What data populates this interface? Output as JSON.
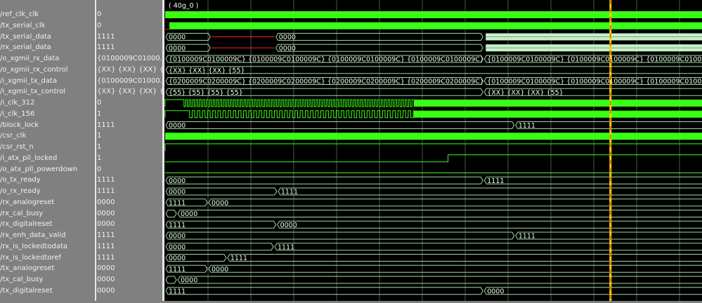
{
  "cursor_label": "( 40g_0 )",
  "cursor_time": 10.39,
  "grid_units": 13,
  "colors": {
    "wave": "#39ff14",
    "bus": "#9fd89f",
    "cursor": "#ffd200",
    "x_state": "#ff2020",
    "grid": "#4a4a4a"
  },
  "signals": [
    {
      "name": "/ref_clk_clk",
      "value": "0",
      "type": "solid",
      "start": 0
    },
    {
      "name": "/tx_serial_clk",
      "value": "0",
      "type": "solid",
      "start": 0.1,
      "red_start": true
    },
    {
      "name": "/tx_serial_data",
      "value": "1111",
      "type": "bus",
      "segs": [
        {
          "t": 0,
          "v": "0000"
        },
        {
          "t": 1.07,
          "v": "",
          "x": true
        },
        {
          "t": 2.57,
          "v": "0000"
        },
        {
          "t": 7.43,
          "v": "",
          "dense": true
        }
      ]
    },
    {
      "name": "/rx_serial_data",
      "value": "1111",
      "type": "bus",
      "segs": [
        {
          "t": 0,
          "v": "0000"
        },
        {
          "t": 1.07,
          "v": "",
          "x": true
        },
        {
          "t": 2.57,
          "v": "0000"
        },
        {
          "t": 7.43,
          "v": "",
          "dense": true
        }
      ]
    },
    {
      "name": "/o_xgmii_rx_data",
      "value": "{0100009C01000...",
      "type": "bus",
      "segs": [
        {
          "t": 0,
          "v": "{0100009C0100009C} {0100009C0100009C} {0100009C0100009C} {0100009C0100009C}"
        },
        {
          "t": 7.43,
          "v": "{0100009C0100009C} {0100009C0100009C} {0100009C01000..."
        }
      ]
    },
    {
      "name": "/o_xgmii_rx_control",
      "value": "{XX} {XX} {XX} {55}",
      "type": "bus",
      "segs": [
        {
          "t": 0,
          "v": "{XX} {XX} {XX} {55}"
        }
      ]
    },
    {
      "name": "/i_xgmii_tx_data",
      "value": "{0100009C01000...",
      "type": "bus",
      "segs": [
        {
          "t": 0,
          "v": "{0200009C0200009C} {0200009C0200009C} {0200009C0200009C} {0200009C0200009C}"
        },
        {
          "t": 7.43,
          "v": "{0100009C0100009C} {0100009C0100009C} {0100009C01000..."
        }
      ]
    },
    {
      "name": "/i_xgmii_tx_control",
      "value": "{XX} {XX} {XX} {55}",
      "type": "bus",
      "segs": [
        {
          "t": 0,
          "v": "{55} {55} {55} {55}"
        },
        {
          "t": 7.43,
          "v": "{XX} {XX} {XX} {55}"
        }
      ]
    },
    {
      "name": "/i_clk_312",
      "value": "0",
      "type": "clock",
      "start": 0.44,
      "solid_from": 5.8,
      "period": 0.08
    },
    {
      "name": "/i_clk_156",
      "value": "1",
      "type": "clock",
      "start": 0.57,
      "solid_from": 5.8,
      "period": 0.12
    },
    {
      "name": "/block_lock",
      "value": "1111",
      "type": "bus",
      "segs": [
        {
          "t": 0,
          "v": "0000"
        },
        {
          "t": 8.16,
          "v": "1111"
        }
      ]
    },
    {
      "name": "/csr_clk",
      "value": "1",
      "type": "solid",
      "start": 0
    },
    {
      "name": "/csr_rst_n",
      "value": "1",
      "type": "bit",
      "edges": [
        {
          "t": 0,
          "v": 1
        }
      ]
    },
    {
      "name": "/i_atx_pll_locked",
      "value": "1",
      "type": "bit",
      "edges": [
        {
          "t": 0,
          "v": 0
        },
        {
          "t": 6.6,
          "v": 1
        }
      ]
    },
    {
      "name": "/o_atx_pll_powerdown",
      "value": "0",
      "type": "bit",
      "edges": [
        {
          "t": 0,
          "v": 0
        }
      ]
    },
    {
      "name": "/o_tx_ready",
      "value": "1111",
      "type": "bus",
      "segs": [
        {
          "t": 0,
          "v": "0000"
        },
        {
          "t": 7.43,
          "v": "1111"
        }
      ]
    },
    {
      "name": "/o_rx_ready",
      "value": "1111",
      "type": "bus",
      "segs": [
        {
          "t": 0,
          "v": "0000"
        },
        {
          "t": 2.62,
          "v": "1111"
        }
      ]
    },
    {
      "name": "/rx_analogreset",
      "value": "0000",
      "type": "bus",
      "segs": [
        {
          "t": 0,
          "v": "1111"
        },
        {
          "t": 1.0,
          "v": "0000"
        }
      ]
    },
    {
      "name": "/rx_cal_busy",
      "value": "0000",
      "type": "bus",
      "segs": [
        {
          "t": 0,
          "v": ""
        },
        {
          "t": 0.28,
          "v": "0000"
        }
      ]
    },
    {
      "name": "/rx_digitalreset",
      "value": "0000",
      "type": "bus",
      "segs": [
        {
          "t": 0,
          "v": "1111"
        },
        {
          "t": 2.6,
          "v": "0000"
        }
      ]
    },
    {
      "name": "/rx_enh_data_valid",
      "value": "1111",
      "type": "bus",
      "segs": [
        {
          "t": 0,
          "v": "0000"
        },
        {
          "t": 8.16,
          "v": "1111"
        }
      ]
    },
    {
      "name": "/rx_is_lockedtodata",
      "value": "1111",
      "type": "bus",
      "segs": [
        {
          "t": 0,
          "v": "0000"
        },
        {
          "t": 2.54,
          "v": "1111"
        }
      ]
    },
    {
      "name": "/rx_is_lockedtoref",
      "value": "1111",
      "type": "bus",
      "segs": [
        {
          "t": 0,
          "v": "0000"
        },
        {
          "t": 1.44,
          "v": "1111"
        }
      ]
    },
    {
      "name": "/tx_analogreset",
      "value": "0000",
      "type": "bus",
      "segs": [
        {
          "t": 0,
          "v": "1111"
        },
        {
          "t": 1.0,
          "v": "0000"
        }
      ]
    },
    {
      "name": "/tx_cal_busy",
      "value": "0000",
      "type": "bus",
      "segs": [
        {
          "t": 0,
          "v": ""
        },
        {
          "t": 0.28,
          "v": "0000"
        }
      ]
    },
    {
      "name": "/tx_digitalreset",
      "value": "0000",
      "type": "bus",
      "segs": [
        {
          "t": 0,
          "v": "1111"
        },
        {
          "t": 7.43,
          "v": "0000"
        }
      ]
    }
  ]
}
